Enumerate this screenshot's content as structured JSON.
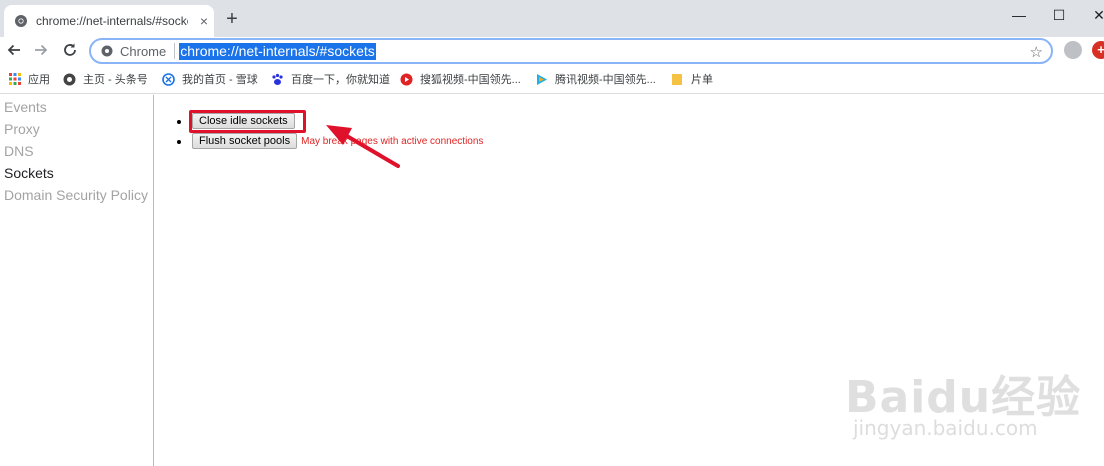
{
  "browser": {
    "tab": {
      "title": "chrome://net-internals/#sockets",
      "close": "×"
    },
    "new_tab": "+",
    "window_controls": {
      "minimize": "—",
      "maximize": "☐",
      "close": "✕"
    },
    "nav": {
      "back_icon": "arrow-left-icon",
      "forward_icon": "arrow-right-icon",
      "reload_icon": "reload-icon"
    },
    "omnibox": {
      "site_label": "Chrome",
      "url": "chrome://net-internals/#sockets",
      "bookmark_icon": "star-icon"
    },
    "bookmarks": [
      {
        "label": "应用",
        "icon": "apps-grid-icon"
      },
      {
        "label": "主页 - 头条号",
        "icon": "toutiao-icon"
      },
      {
        "label": "我的首页 - 雪球",
        "icon": "xueqiu-icon"
      },
      {
        "label": "百度一下，你就知道",
        "icon": "baidu-paw-icon"
      },
      {
        "label": "搜狐视频-中国领先...",
        "icon": "sohu-video-icon"
      },
      {
        "label": "腾讯视频-中国领先...",
        "icon": "tencent-video-icon"
      },
      {
        "label": "片单",
        "icon": "folder-icon"
      }
    ]
  },
  "sidebar": {
    "items": [
      {
        "label": "Events",
        "active": false
      },
      {
        "label": "Proxy",
        "active": false
      },
      {
        "label": "DNS",
        "active": false
      },
      {
        "label": "Sockets",
        "active": true
      },
      {
        "label": "Domain Security Policy",
        "active": false
      }
    ]
  },
  "main": {
    "close_idle_label": "Close idle sockets",
    "flush_pools_label": "Flush socket pools",
    "flush_warning": "May break pages with active connections"
  },
  "watermark": {
    "logo": "Baidu经验",
    "url": "jingyan.baidu.com"
  },
  "colors": {
    "accent": "#1a73e8",
    "highlight": "#e0112b",
    "warning": "#e02424"
  }
}
